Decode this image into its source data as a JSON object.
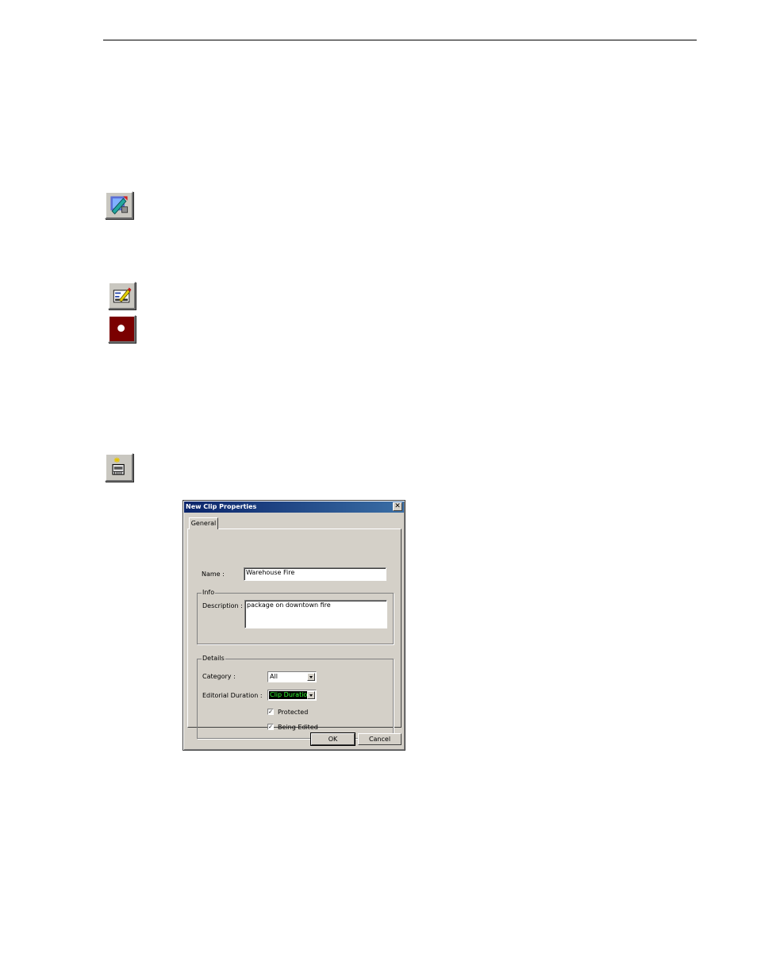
{
  "toolbar_icons": [
    {
      "icon": "edit-tools-icon"
    },
    {
      "icon": "edit-properties-icon"
    },
    {
      "icon": "record-icon",
      "color": "#7a0000"
    },
    {
      "icon": "new-clip-icon"
    }
  ],
  "dialog": {
    "title": "New Clip Properties",
    "close_glyph": "✕",
    "tab_general": "General",
    "name_label": "Name :",
    "name_value": "Warehouse Fire",
    "info_group": "Info",
    "description_label": "Description :",
    "description_value": "package on downtown fire",
    "details_group": "Details",
    "category_label": "Category :",
    "category_value": "All",
    "duration_label": "Editorial Duration :",
    "duration_value": "Clip Duration",
    "protected_label": "Protected",
    "protected_checked": true,
    "being_edited_label": "Being Edited",
    "being_edited_checked": true,
    "check_glyph": "✓",
    "ok_label": "OK",
    "cancel_label": "Cancel",
    "title_bar_color": "#0a246a"
  }
}
